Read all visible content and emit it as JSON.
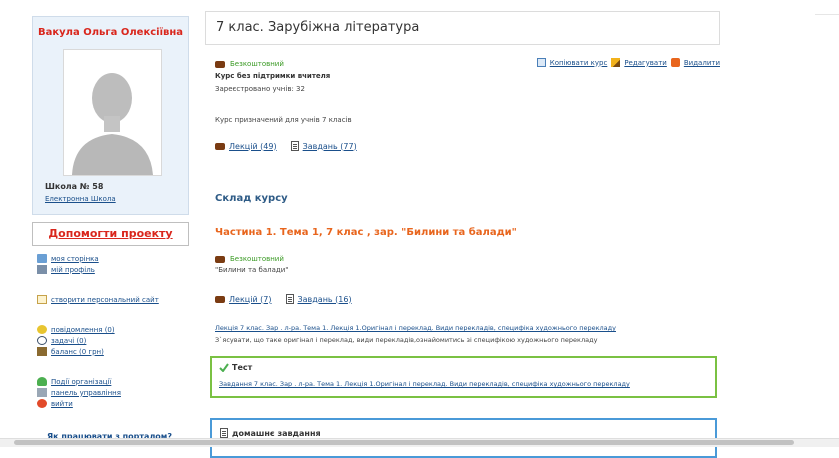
{
  "sidebar": {
    "user_name": "Вакула Ольга Олексіївна",
    "school_name": "Школа № 58",
    "school_link": "Електронна Школа",
    "help_project": "Допомогти проекту",
    "menu": [
      {
        "label": "моя сторінка",
        "icon": "home-icon"
      },
      {
        "label": "мій профіль",
        "icon": "profile-icon"
      },
      {
        "label": "створити персональний сайт",
        "icon": "site-icon"
      },
      {
        "label": "повідомлення (0)",
        "icon": "message-icon"
      },
      {
        "label": "задачі (0)",
        "icon": "clock-icon"
      },
      {
        "label": "баланс (0 грн)",
        "icon": "wallet-icon"
      },
      {
        "label": "Події організації",
        "icon": "events-icon"
      },
      {
        "label": "панель управління",
        "icon": "panel-icon"
      },
      {
        "label": "вийти",
        "icon": "exit-icon"
      }
    ],
    "portal_help": "Як працювати з порталом?"
  },
  "course": {
    "title": "7 клас. Зарубіжна література",
    "free_tag": "Безкоштовний",
    "actions": {
      "copy": "Копіювати курс",
      "edit": "Редагувати",
      "delete": "Видалити"
    },
    "no_teacher": "Курс без підтримки вчителя",
    "registered": "Зареєстровано учнів: 32",
    "purpose": "Курс призначений для учнів 7 класів",
    "lectures": "Лекцій (49)",
    "tasks": "Завдань (77)"
  },
  "composition": {
    "heading": "Склад курсу",
    "part": {
      "title": "Частина 1. Тема 1, 7 клас , зар. \"Билини та балади\"",
      "free_tag": "Безкоштовний",
      "description": "\"Билини та балади\"",
      "lectures": "Лекцій (7)",
      "tasks": "Завдань (16)",
      "lecture_link": "Лекція 7 клас. Зар . л-ра. Тема 1. Лекція 1.Оригінал і переклад. Види перекладів, специфіка художнього перекладу",
      "lecture_desc": "З`ясувати, що таке оригінал і переклад, види перекладів,ознайомитись зі специфікою художнього перекладу",
      "test_title": "Тест",
      "test_link": "Завдання 7 клас. Зар . л-ра. Тема 1. Лекція 1.Оригінал і переклад. Види перекладів, специфіка художнього перекладу",
      "homework_title": "домашнє завдання"
    }
  },
  "colors": {
    "accent_red": "#d9261c",
    "orange": "#e8651d",
    "green": "#7ac143",
    "blue": "#4a9ad8",
    "link": "#1a4f8b"
  }
}
